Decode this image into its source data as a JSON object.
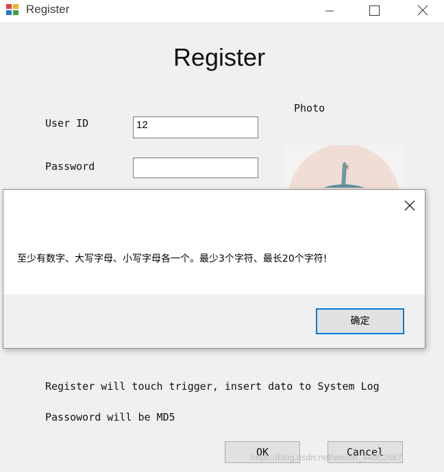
{
  "window": {
    "title": "Register",
    "icon": "app-icon",
    "controls": [
      "minimize-icon",
      "maximize-icon",
      "close-icon"
    ]
  },
  "form": {
    "heading": "Register",
    "user_id_label": "User ID",
    "user_id_value": "12",
    "password_label": "Password",
    "password_value": "",
    "photo_label": "Photo",
    "note1": "Register will touch trigger, insert dato to System Log",
    "note2": "Passoword will be MD5",
    "ok_label": "OK",
    "cancel_label": "Cancel"
  },
  "dialog": {
    "message": "至少有数字、大写字母、小写字母各一个。最少3个字符、最长20个字符!",
    "confirm_label": "确定",
    "accent": "#0078d7"
  },
  "watermark": "https://blog.csdn.net/weixin_44652687"
}
